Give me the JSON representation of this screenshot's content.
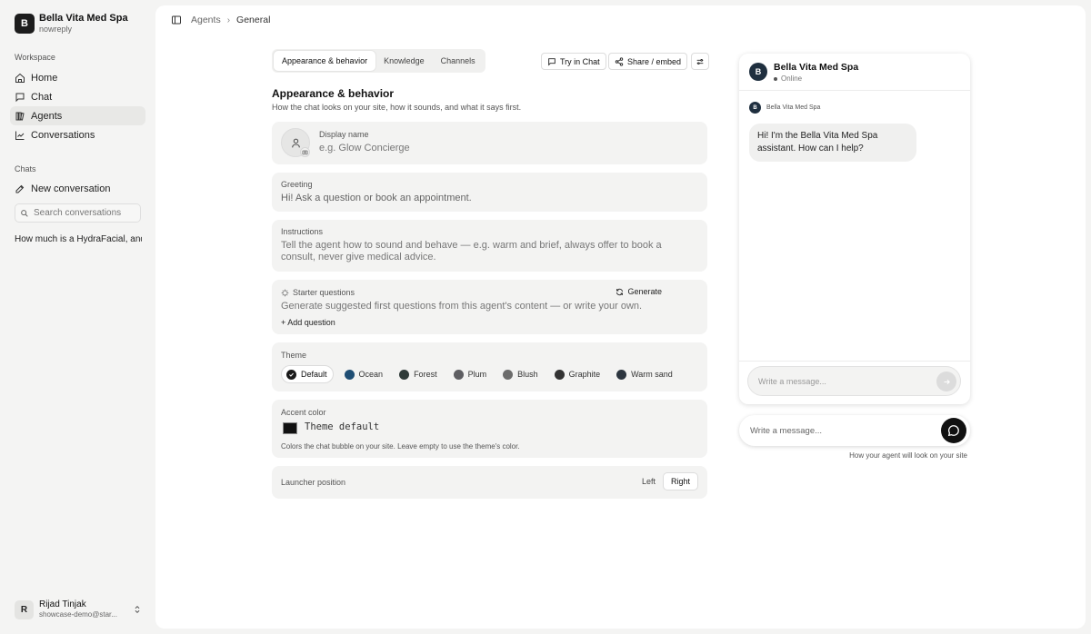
{
  "workspace": {
    "initial": "B",
    "name": "Bella Vita Med Spa",
    "subtitle": "nowreply"
  },
  "sidebar": {
    "workspace_label": "Workspace",
    "items": [
      {
        "label": "Home",
        "icon": "home-icon"
      },
      {
        "label": "Chat",
        "icon": "chat-icon"
      },
      {
        "label": "Agents",
        "icon": "agents-icon",
        "active": true
      },
      {
        "label": "Conversations",
        "icon": "chart-icon"
      }
    ],
    "chats_label": "Chats",
    "new_conversation": "New conversation",
    "search_placeholder": "Search conversations",
    "conversations": [
      "How much is a HydraFacial, and..."
    ]
  },
  "user": {
    "initial": "R",
    "name": "Rijad Tinjak",
    "email": "showcase-demo@star..."
  },
  "breadcrumb": {
    "parent": "Agents",
    "current": "General"
  },
  "tabs": [
    "Appearance & behavior",
    "Knowledge",
    "Channels"
  ],
  "header_actions": {
    "try": "Try in Chat",
    "share": "Share / embed"
  },
  "section": {
    "title": "Appearance & behavior",
    "description": "How the chat looks on your site, how it sounds, and what it says first."
  },
  "display_name": {
    "label": "Display name",
    "placeholder": "e.g. Glow Concierge"
  },
  "greeting": {
    "label": "Greeting",
    "value": "Hi! Ask a question or book an appointment."
  },
  "instructions": {
    "label": "Instructions",
    "placeholder": "Tell the agent how to sound and behave — e.g. warm and brief, always offer to book a consult, never give medical advice."
  },
  "starter": {
    "label": "Starter questions",
    "generate": "Generate",
    "description": "Generate suggested first questions from this agent's content — or write your own.",
    "add": "+ Add question"
  },
  "theme": {
    "label": "Theme",
    "options": [
      {
        "name": "Default",
        "color": "#1a1a1a",
        "selected": true
      },
      {
        "name": "Ocean",
        "color": "#1f4e74"
      },
      {
        "name": "Forest",
        "color": "#2f3b39"
      },
      {
        "name": "Plum",
        "color": "#5e5e62"
      },
      {
        "name": "Blush",
        "color": "#6c6c6c"
      },
      {
        "name": "Graphite",
        "color": "#333333"
      },
      {
        "name": "Warm sand",
        "color": "#2d3640"
      }
    ]
  },
  "accent": {
    "label": "Accent color",
    "value": "Theme default",
    "help": "Colors the chat bubble on your site. Leave empty to use the theme's color."
  },
  "launcher_position": {
    "label": "Launcher position",
    "options": [
      "Left",
      "Right"
    ],
    "selected": "Right"
  },
  "preview": {
    "avatar": "B",
    "name": "Bella Vita Med Spa",
    "status": "Online",
    "agent_label": "Bella Vita Med Spa",
    "greeting": "Hi! I'm the Bella Vita Med Spa assistant. How can I help?",
    "input_placeholder": "Write a message...",
    "launcher_placeholder": "Write a message...",
    "caption": "How your agent will look on your site"
  }
}
